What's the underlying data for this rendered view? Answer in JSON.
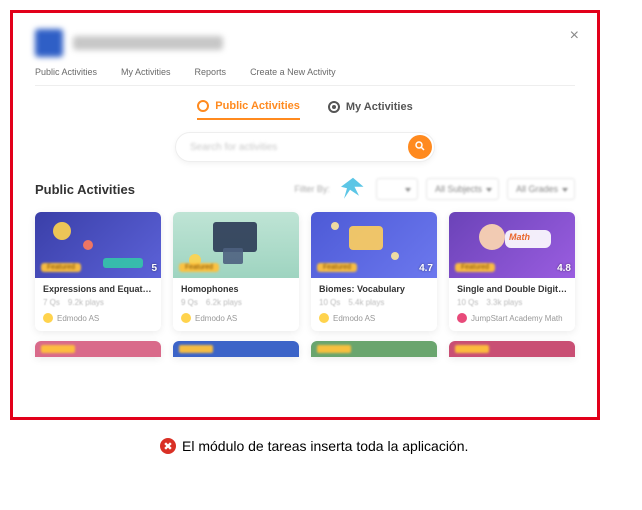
{
  "close_label": "×",
  "brand": {
    "name_blurred": "(app name)"
  },
  "topnav": {
    "items": [
      "Public Activities",
      "My Activities",
      "Reports",
      "Create a New Activity"
    ]
  },
  "tabs": {
    "public": "Public Activities",
    "mine": "My Activities"
  },
  "search": {
    "placeholder": "Search for activities"
  },
  "section": {
    "title": "Public Activities",
    "filter_label": "Filter By:",
    "selects": {
      "blank": "",
      "subjects": "All Subjects",
      "grades": "All Grades"
    }
  },
  "cards": [
    {
      "title": "Expressions and Equati…",
      "qs": "7 Qs",
      "plays": "9.2k plays",
      "rating": "5",
      "source": "Edmodo AS",
      "badge": "Featured"
    },
    {
      "title": "Homophones",
      "qs": "9 Qs",
      "plays": "6.2k plays",
      "rating": "",
      "source": "Edmodo AS",
      "badge": "Featured"
    },
    {
      "title": "Biomes: Vocabulary",
      "qs": "10 Qs",
      "plays": "5.4k plays",
      "rating": "4.7",
      "source": "Edmodo AS",
      "badge": "Featured"
    },
    {
      "title": "Single and Double Digit…",
      "qs": "10 Qs",
      "plays": "3.3k plays",
      "rating": "4.8",
      "source": "JumpStart Academy Math",
      "badge": "Featured",
      "math_label": "Math"
    }
  ],
  "caption": {
    "text": "El módulo de tareas inserta toda la aplicación.",
    "icon_glyph": "✖"
  }
}
